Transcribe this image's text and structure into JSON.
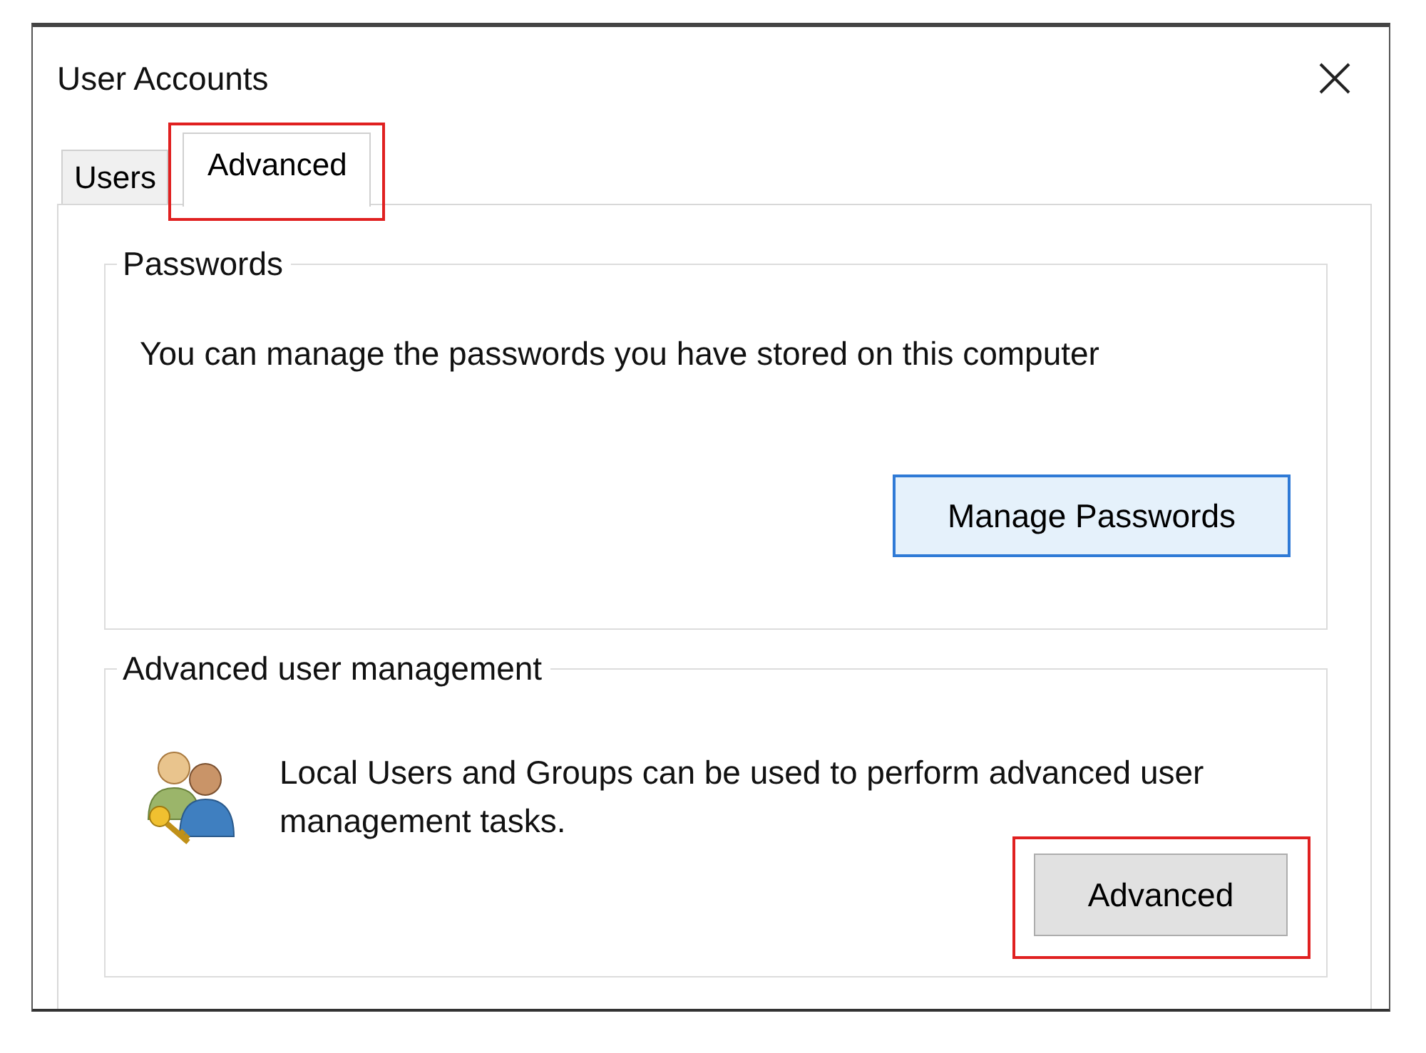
{
  "window": {
    "title": "User Accounts"
  },
  "tabs": [
    {
      "label": "Users",
      "selected": false,
      "highlighted": false
    },
    {
      "label": "Advanced",
      "selected": true,
      "highlighted": true
    }
  ],
  "groups": [
    {
      "kind": "passwords",
      "title": "Passwords",
      "text": "You can manage the passwords you have stored on this computer",
      "button": {
        "label": "Manage Passwords",
        "focused": true,
        "highlighted": false
      }
    },
    {
      "kind": "user-management",
      "title": "Advanced user management",
      "text": "Local Users and Groups can be used to perform advanced user management tasks.",
      "button": {
        "label": "Advanced",
        "focused": false,
        "highlighted": true
      }
    }
  ]
}
